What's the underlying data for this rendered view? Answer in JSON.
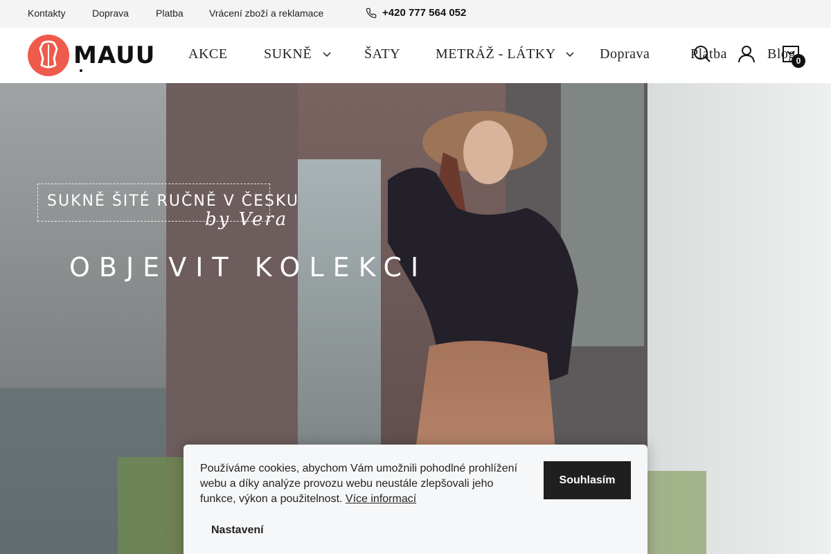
{
  "topbar": {
    "links": [
      "Kontakty",
      "Doprava",
      "Platba",
      "Vrácení zboží a reklamace"
    ],
    "phone": "+420 777 564 052"
  },
  "header": {
    "logo_text": "MAUU",
    "nav": [
      "AKCE",
      "SUKNĚ",
      "ŠATY",
      "METRÁŽ - LÁTKY",
      "Doprava",
      "Platba",
      "Blog"
    ],
    "cart_count": "0"
  },
  "hero": {
    "subtitle": "SUKNĚ ŠITÉ RUČNĚ V ČESKU",
    "signature": "by Vera",
    "cta": "OBJEVIT KOLEKCI"
  },
  "cookie": {
    "text": "Používáme cookies, abychom Vám umožnili pohodlné prohlížení webu a díky analýze provozu webu neustále zlepšovali jeho funkce, výkon a použitelnost.",
    "more_link": "Více informací",
    "accept_label": "Souhlasím",
    "settings_label": "Nastavení"
  }
}
